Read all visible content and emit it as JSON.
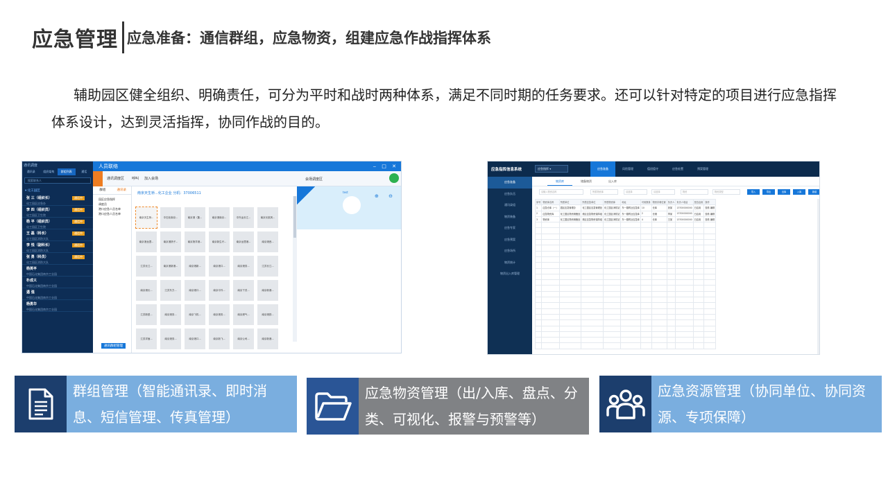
{
  "title": {
    "main": "应急管理",
    "sub": "应急准备：通信群组，应急物资，组建应急作战指挥体系"
  },
  "intro": "辅助园区健全组织、明确责任，可分为平时和战时两种体系，满足不同时期的任务要求。还可以针对特定的项目进行应急指挥体系设计，达到灵活指挥，协同作战的目的。",
  "left_screenshot": {
    "window_title": "人员联络",
    "window_buttons": "‒ □ ✕",
    "side_head": "通讯调度",
    "side_tabs": [
      "通讯录",
      "组织架构",
      "群组列表",
      "通话"
    ],
    "search_placeholder": "搜索联系人",
    "group_label": "▾ 化工园区",
    "contacts": [
      {
        "name": "张 三（组织长）",
        "org": "化工园区应急办",
        "badge": "通话中"
      },
      {
        "name": "李 四（组织员）",
        "org": "化工园区卫生院",
        "badge": "通话中"
      },
      {
        "name": "杨 平（组织员）",
        "org": "化工园区卫生院",
        "badge": "通话中"
      },
      {
        "name": "王 磊（科长）",
        "org": "化工园区消防大队",
        "badge": "通话中"
      },
      {
        "name": "李 悦（副科长）",
        "org": "化工园区消防大队",
        "badge": "通话中"
      },
      {
        "name": "张 勇（科员）",
        "org": "化工园区消防大队",
        "badge": "通话中"
      },
      {
        "name": "杨英平",
        "org": "中国石化集团南京工业园",
        "badge": ""
      },
      {
        "name": "朴成义",
        "org": "中国石化集团南京工业园",
        "badge": ""
      },
      {
        "name": "遇 强",
        "org": "中国石化集团南京工业园",
        "badge": ""
      },
      {
        "name": "杨勇华",
        "org": "中国石化集团南京工业园",
        "badge": ""
      }
    ],
    "toolbar": [
      "通讯调度区",
      "呼叫",
      "加入会场"
    ],
    "zone_label": "会场调度区",
    "tree_tabs": [
      "群组",
      "通讯录"
    ],
    "tree_items": [
      "园区应急指挥",
      "调度员",
      "港口应急人员名单",
      "港口应急人员名单"
    ],
    "tree_button": "通讯群组管理",
    "grid_header": "南京天生桥...化工企业  分机：37006511",
    "grid_cells": [
      "南京天生桥...",
      "中石化南京...",
      "南京港（集...",
      "南京港南京...",
      "中外运长江...",
      "南京长航风...",
      "南京港龙潭...",
      "南京港扬子...",
      "南京扬洋港...",
      "南京新生圩...",
      "南京龙潭港...",
      "南京港西...",
      "江苏长江...",
      "南京港新港...",
      "南京港新...",
      "南京港口...",
      "南京港务...",
      "江苏长江...",
      "南京港长...",
      "江苏东方...",
      "南京港口...",
      "南京中外...",
      "南京下关...",
      "南京新港...",
      "江苏新型...",
      "南京港务...",
      "南京飞机...",
      "南京港务...",
      "南京燃气...",
      "南京港铁...",
      "江苏洋面...",
      "南京港务...",
      "南京港口...",
      "南京新飞...",
      "南京公司...",
      "南京新港..."
    ],
    "panel_icons": "⊕ ⊖",
    "panel_name": "test"
  },
  "right_screenshot": {
    "brand": "应急指挥信息系统",
    "select_value": "应急指挥 ▾",
    "nav": [
      "应急准备",
      "风险管理",
      "值班值守",
      "应急处置",
      "预案管理"
    ],
    "side": [
      "应急准备",
      "应急队伍",
      "通讯录组",
      "物资装备",
      "应急专家",
      "应急预案",
      "应急场所",
      "物资统计",
      "物资出入库管理"
    ],
    "tabs": [
      "物资库",
      "储备物资",
      "出入库"
    ],
    "filters": [
      "请输入物资名称",
      "所属物资库",
      "请选择",
      "请选择",
      "物资",
      "物资类型"
    ],
    "buttons": [
      "导入",
      "导出",
      "出库",
      "入库",
      "新增"
    ],
    "table_headers": [
      "序号",
      "物资库名称",
      "所属单位",
      "所属应急单位",
      "所属物资库",
      "地址",
      "可用数量",
      "物资存储位置",
      "负责人",
      "负责人电话",
      "是否启用",
      "操作"
    ],
    "table_rows": [
      [
        "1",
        "应急仓库（一）",
        "园区应急管理办",
        "化工园区应急管理处",
        "化工园区消防站",
        "东一路附近应急库",
        "10",
        "仓库",
        "张某",
        "13700000000",
        "已启用",
        "查看 编辑"
      ],
      [
        "2",
        "应急物资库",
        "化工园区物资储备处",
        "港区应急物资保障组",
        "化工园区消防站",
        "东一路附近应急库",
        "2",
        "仓储",
        "李某",
        "13700000000",
        "已启用",
        "查看 编辑"
      ],
      [
        "3",
        "物资库",
        "化工园区物资储备处",
        "港区应急物资保障组",
        "化工园区消防站",
        "东一路附近应急库",
        "4",
        "仓库",
        "王某",
        "13700000000",
        "已启用",
        "查看 编辑"
      ]
    ]
  },
  "cards": [
    {
      "icon": "document-icon",
      "text": "群组管理（智能通讯录、即时消息、短信管理、传真管理）"
    },
    {
      "icon": "folder-icon",
      "text": "应急物资管理（出/入库、盘点、分类、可视化、报警与预警等）"
    },
    {
      "icon": "group-icon",
      "text": "应急资源管理（协同单位、协同资源、专项保障）"
    }
  ],
  "colors": {
    "card_dark": "#1c3e6d",
    "card_light": "#7aaedf",
    "card_gray": "#808285",
    "accent_blue": "#1677d9"
  }
}
